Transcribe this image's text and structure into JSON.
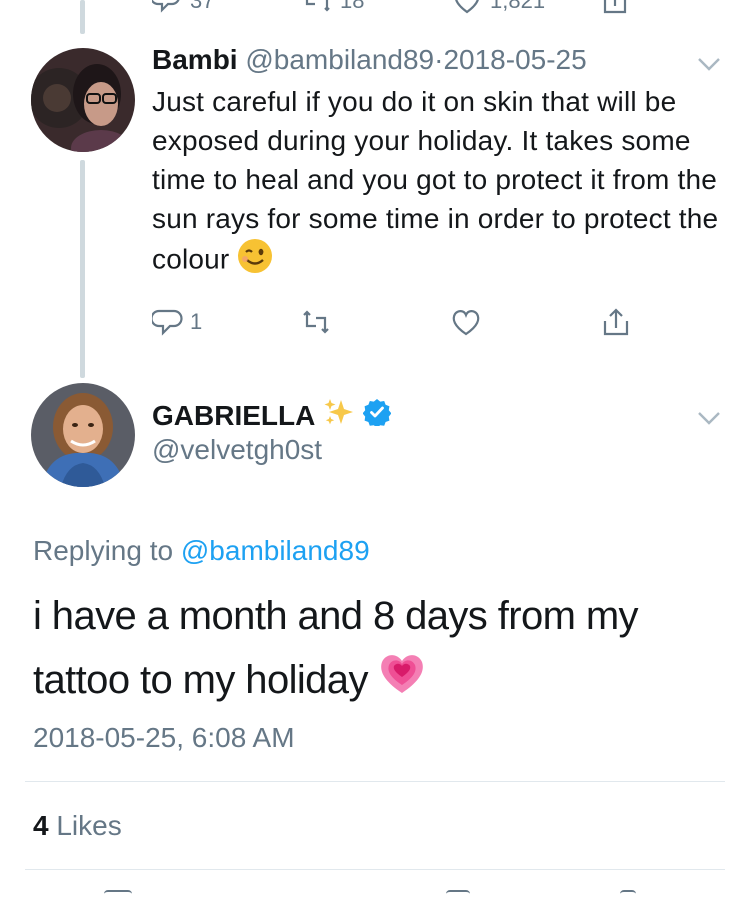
{
  "top_actions": {
    "reply_count": "37",
    "retweet_count": "18",
    "like_count": "1,821"
  },
  "reply": {
    "name": "Bambi",
    "handle": "@bambiland89",
    "separator": "·",
    "date": "2018-05-25",
    "text": "Just careful if you do it on skin that will be exposed during your holiday. It takes some time to heal and you got to protect it from the sun rays for some time in order to protect the colour",
    "emoji": "winking-face",
    "reply_count": "1"
  },
  "tweet": {
    "name": "GABRIELLA",
    "name_emoji": "sparkles",
    "verified": true,
    "handle": "@velvetgh0st",
    "replying_prefix": "Replying to",
    "replying_handle": "@bambiland89",
    "text": "i have a month and 8 days from my tattoo to my holiday",
    "text_emoji": "growing-heart",
    "timestamp": "2018-05-25, 6:08 AM",
    "likes_count": "4",
    "likes_label": "Likes"
  },
  "colors": {
    "text": "#14171a",
    "muted": "#657786",
    "link": "#1da1f2",
    "line": "#cfd9de"
  }
}
